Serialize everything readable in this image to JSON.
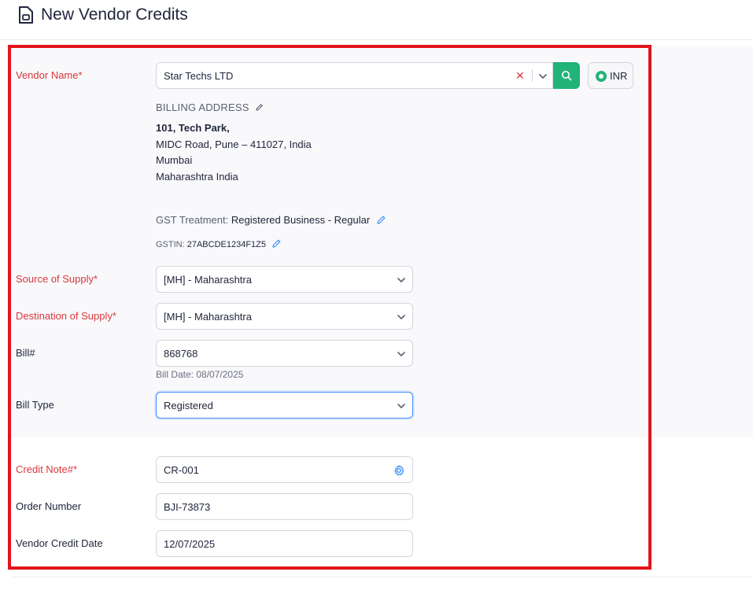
{
  "header": {
    "title": "New Vendor Credits",
    "icon": "document-icon"
  },
  "vendor": {
    "label": "Vendor Name*",
    "value": "Star Techs LTD",
    "clear_symbol": "✕",
    "currency": "INR"
  },
  "billing": {
    "heading": "BILLING ADDRESS",
    "line1": "101, Tech Park,",
    "line2": "MIDC Road, Pune – 411027, India",
    "line3": "Mumbai",
    "line4": "Maharashtra India"
  },
  "gst": {
    "treatment_label": "GST Treatment:",
    "treatment_value": "Registered Business - Regular",
    "gstin_label": "GSTIN:",
    "gstin_value": "27ABCDE1234F1Z5"
  },
  "form": {
    "source_label": "Source of Supply*",
    "source_value": "[MH] - Maharashtra",
    "destination_label": "Destination of Supply*",
    "destination_value": "[MH] - Maharashtra",
    "bill_label": "Bill#",
    "bill_value": "868768",
    "bill_date_hint": "Bill Date: 08/07/2025",
    "bill_type_label": "Bill Type",
    "bill_type_value": "Registered",
    "credit_note_label": "Credit Note#*",
    "credit_note_value": "CR-001",
    "order_label": "Order Number",
    "order_value": "BJI-73873",
    "date_label": "Vendor Credit Date",
    "date_value": "12/07/2025"
  },
  "colors": {
    "required": "#d6373c",
    "highlight_frame": "#e3141c",
    "search_button": "#22b378",
    "link_blue": "#408dfb"
  }
}
